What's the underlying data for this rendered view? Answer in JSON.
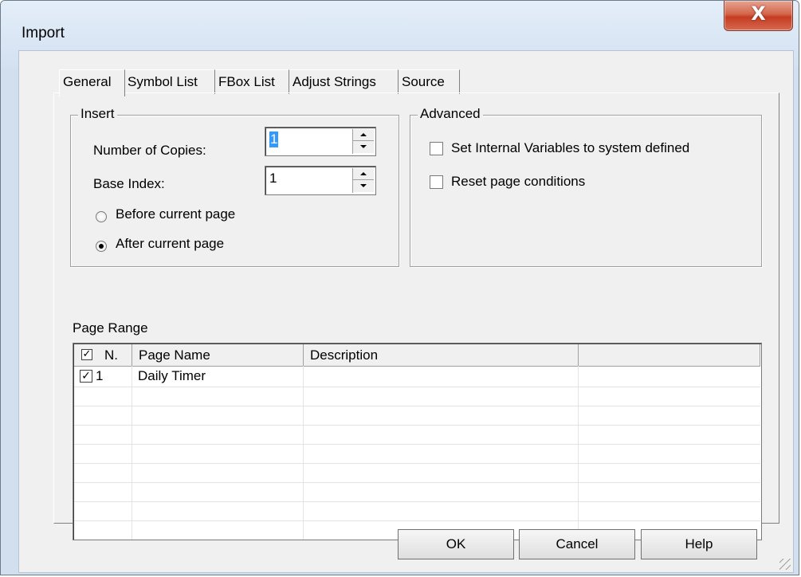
{
  "window": {
    "title": "Import",
    "close_symbol": "X"
  },
  "tabs": [
    {
      "label": "General",
      "active": true
    },
    {
      "label": "Symbol List",
      "active": false
    },
    {
      "label": "FBox List",
      "active": false
    },
    {
      "label": "Adjust Strings",
      "active": false
    },
    {
      "label": "Source",
      "active": false
    }
  ],
  "insert": {
    "legend": "Insert",
    "copies_label": "Number of Copies:",
    "copies_value": "1",
    "base_index_label": "Base Index:",
    "base_index_value": "1",
    "before_label": "Before current page",
    "after_label": "After current page",
    "selected_position": "after"
  },
  "advanced": {
    "legend": "Advanced",
    "opt1_label": "Set Internal Variables to system defined",
    "opt1_checked": false,
    "opt2_label": "Reset page conditions",
    "opt2_checked": false
  },
  "page_range": {
    "label": "Page Range",
    "columns": [
      "N.",
      "Page Name",
      "Description",
      ""
    ],
    "header_checked": true,
    "rows": [
      {
        "checked": true,
        "number": "1",
        "name": "Daily Timer",
        "description": ""
      }
    ]
  },
  "buttons": {
    "ok": "OK",
    "cancel": "Cancel",
    "help": "Help"
  },
  "colors": {
    "selection": "#3399ff",
    "close_button": "#c53c22",
    "frame": "#d2dfee"
  }
}
